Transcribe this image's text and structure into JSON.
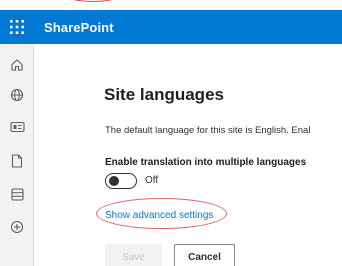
{
  "suite": {
    "brand": "SharePoint",
    "brand_color": "#0078d4"
  },
  "appbar": {
    "items": [
      {
        "icon": "home-icon"
      },
      {
        "icon": "globe-icon"
      },
      {
        "icon": "news-icon"
      },
      {
        "icon": "file-icon"
      },
      {
        "icon": "list-icon"
      },
      {
        "icon": "add-icon"
      }
    ]
  },
  "page": {
    "title": "Site languages",
    "description": "The default language for this site is English. Enal",
    "translation_label": "Enable translation into multiple languages",
    "toggle_state": "Off",
    "advanced_link": "Show advanced settings",
    "save_label": "Save",
    "cancel_label": "Cancel"
  }
}
